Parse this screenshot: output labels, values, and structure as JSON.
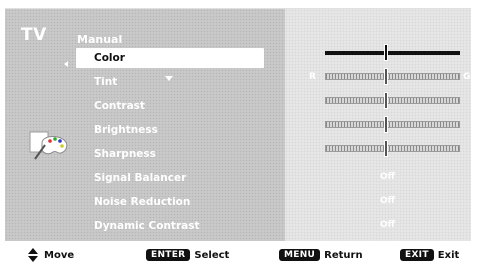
{
  "header": {
    "title": "TV",
    "subtitle": "Manual"
  },
  "menu": {
    "items": [
      {
        "label": "Color",
        "selected": true
      },
      {
        "label": "Tint",
        "selected": false
      },
      {
        "label": "Contrast",
        "selected": false
      },
      {
        "label": "Brightness",
        "selected": false
      },
      {
        "label": "Sharpness",
        "selected": false
      },
      {
        "label": "Signal Balancer",
        "selected": false
      },
      {
        "label": "Noise Reduction",
        "selected": false
      },
      {
        "label": "Dynamic Contrast",
        "selected": false
      }
    ]
  },
  "settings": {
    "color_level": 0.5,
    "tint_level": 0.5,
    "tint_left_label": "R",
    "tint_right_label": "G",
    "contrast_level": 0.5,
    "brightness_level": 0.5,
    "sharpness_level": 0.5,
    "signal_balancer_value": "Off",
    "noise_reduction_value": "Off",
    "dynamic_contrast_value": "Off"
  },
  "footer": {
    "move_label": "Move",
    "enter_key": "ENTER",
    "enter_label": "Select",
    "menu_key": "MENU",
    "menu_label": "Return",
    "exit_key": "EXIT",
    "exit_label": "Exit"
  },
  "icons": {
    "category_icon": "palette-icon",
    "nav_icon": "up-down-arrow-icon"
  },
  "colors": {
    "panel_bg": "#c9c9c9",
    "right_panel_bg": "#e6e6e6",
    "selected_bg": "#ffffff",
    "text": "#ffffff"
  }
}
